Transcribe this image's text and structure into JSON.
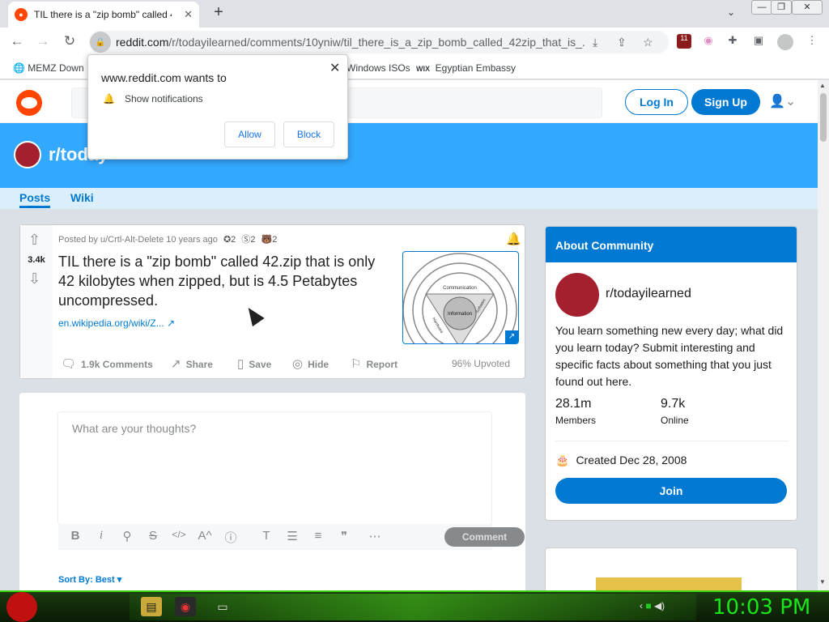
{
  "browser": {
    "tab_title": "TIL there is a \"zip bomb\" called 4",
    "tab_close": "✕",
    "new_tab": "+",
    "url_domain": "reddit.com",
    "url_path": "/r/todayilearned/comments/10yniw/til_there_is_a_zip_bomb_called_42zip_that_is_...",
    "ext_badge": "11",
    "bookmarks": [
      "MEMZ Down",
      "Windows ISOs",
      "Egyptian Embassy"
    ]
  },
  "popup": {
    "title": "www.reddit.com wants to",
    "permission": "Show notifications",
    "allow": "Allow",
    "block": "Block",
    "close": "✕"
  },
  "header": {
    "login": "Log In",
    "signup": "Sign Up"
  },
  "subreddit": {
    "name": "r/today",
    "tabs": [
      "Posts",
      "Wiki"
    ]
  },
  "post": {
    "votes": "3.4k",
    "meta": "Posted by u/Crtl-Alt-Delete 10 years ago",
    "awards": [
      "2",
      "2",
      "2"
    ],
    "title": "TIL there is a \"zip bomb\" called 42.zip that is only 42 kilobytes when zipped, but is 4.5 Petabytes uncompressed.",
    "link": "en.wikipedia.org/wiki/Z...",
    "thumb_labels": [
      "Communication",
      "Information",
      "Hardware",
      "Software"
    ],
    "actions": {
      "comments": "1.9k Comments",
      "share": "Share",
      "save": "Save",
      "hide": "Hide",
      "report": "Report"
    },
    "upvoted": "96% Upvoted"
  },
  "comment": {
    "placeholder": "What are your thoughts?",
    "button": "Comment",
    "sort": "Sort By: Best"
  },
  "about": {
    "header": "About Community",
    "name": "r/todayilearned",
    "description": "You learn something new every day; what did you learn today? Submit interesting and specific facts about something that you just found out here.",
    "members_value": "28.1m",
    "members_label": "Members",
    "online_value": "9.7k",
    "online_label": "Online",
    "created": "Created Dec 28, 2008",
    "join": "Join"
  },
  "taskbar": {
    "clock": "10:03 PM"
  },
  "colors": {
    "reddit_orange": "#ff4500",
    "reddit_blue": "#0079d3",
    "banner": "#33a8ff",
    "clock_green": "#19e519"
  }
}
